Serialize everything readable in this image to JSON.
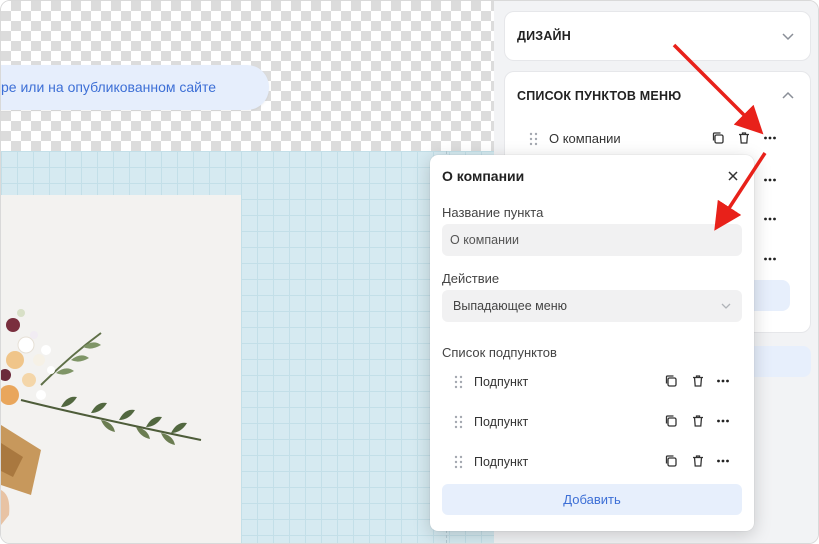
{
  "canvas": {
    "hint_text": "ре или на опубликованном сайте"
  },
  "panel": {
    "design_section": {
      "title": "ДИЗАЙН"
    },
    "menu_section": {
      "title": "СПИСОК ПУНКТОВ МЕНЮ",
      "first_item_label": "О компании"
    }
  },
  "popup": {
    "title": "О компании",
    "name_label": "Название пункта",
    "name_value": "О компании",
    "action_label": "Действие",
    "action_value": "Выпадающее меню",
    "subitems_label": "Список подпунктов",
    "subitems": [
      {
        "label": "Подпункт"
      },
      {
        "label": "Подпункт"
      },
      {
        "label": "Подпункт"
      }
    ],
    "add_label": "Добавить"
  },
  "colors": {
    "accent": "#3d6fd6",
    "accent_bg": "#e7effc",
    "annotation_arrow": "#e8211a",
    "canvas_grid": "#d6eaf1"
  },
  "icons": [
    "chevron-down-icon",
    "chevron-up-icon",
    "drag-handle-icon",
    "copy-icon",
    "trash-icon",
    "more-icon",
    "close-icon"
  ]
}
